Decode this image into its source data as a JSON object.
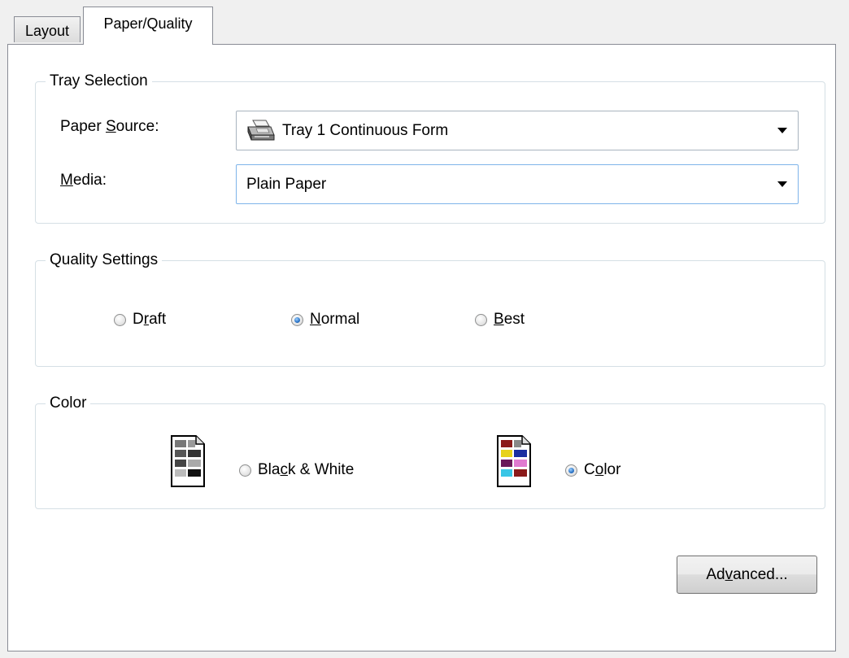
{
  "tabs": [
    {
      "label": "Layout",
      "active": false
    },
    {
      "label": "Paper/Quality",
      "active": true
    }
  ],
  "tray_selection": {
    "title": "Tray Selection",
    "paper_source": {
      "label_pre": "Paper ",
      "label_key": "S",
      "label_post": "ource:",
      "value": "Tray 1 Continuous Form",
      "icon": "printer-icon"
    },
    "media": {
      "label_pre": "",
      "label_key": "M",
      "label_post": "edia:",
      "value": "Plain Paper"
    }
  },
  "quality_settings": {
    "title": "Quality Settings",
    "options": [
      {
        "pre": "D",
        "key": "r",
        "post": "aft",
        "checked": false
      },
      {
        "pre": "",
        "key": "N",
        "post": "ormal",
        "checked": true
      },
      {
        "pre": "",
        "key": "B",
        "post": "est",
        "checked": false
      }
    ]
  },
  "color": {
    "title": "Color",
    "options": [
      {
        "pre": "Bla",
        "key": "c",
        "post": "k & White",
        "checked": false,
        "icon": "grayscale-document-icon"
      },
      {
        "pre": "C",
        "key": "o",
        "post": "lor",
        "checked": true,
        "icon": "color-document-icon"
      }
    ]
  },
  "buttons": {
    "advanced": {
      "pre": "Ad",
      "key": "v",
      "post": "anced..."
    }
  },
  "colors": {
    "window_bg": "#f0f0f0",
    "panel_bg": "#ffffff",
    "group_border": "#d5dfe5",
    "radio_checked": "#2a73c6"
  }
}
